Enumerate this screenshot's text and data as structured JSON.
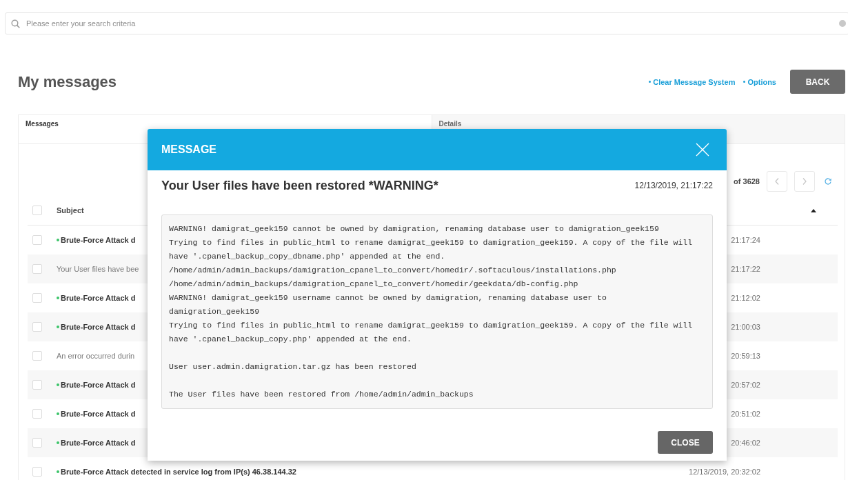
{
  "search": {
    "placeholder": "Please enter your search criteria"
  },
  "page": {
    "title": "My messages",
    "links": [
      "Clear Message System",
      "Options"
    ],
    "back_button": "BACK"
  },
  "panel": {
    "tabs": [
      {
        "label": "Messages",
        "selected": true
      },
      {
        "label": "Details",
        "selected": false
      }
    ],
    "pagination": {
      "summary": "of 3628"
    },
    "table": {
      "select_all": {
        "checked": false
      },
      "columns": [
        "Subject"
      ],
      "rows": [
        {
          "subject": "Brute-Force Attack d",
          "date": "21:17:24",
          "unread": true,
          "checked": false
        },
        {
          "subject": "Your User files have bee",
          "date": "21:17:22",
          "unread": false,
          "checked": false
        },
        {
          "subject": "Brute-Force Attack d",
          "date": "21:12:02",
          "unread": true,
          "checked": false
        },
        {
          "subject": "Brute-Force Attack d",
          "date": "21:00:03",
          "unread": true,
          "checked": false
        },
        {
          "subject": "An error occurred durin",
          "date": "20:59:13",
          "unread": false,
          "checked": false
        },
        {
          "subject": "Brute-Force Attack d",
          "date": "20:57:02",
          "unread": true,
          "checked": false
        },
        {
          "subject": "Brute-Force Attack d",
          "date": "20:51:02",
          "unread": true,
          "checked": false
        },
        {
          "subject": "Brute-Force Attack d",
          "date": "20:46:02",
          "unread": true,
          "checked": false
        },
        {
          "subject": "Brute-Force Attack detected in service log from IP(s) 46.38.144.32",
          "date": "12/13/2019, 20:32:02",
          "unread": true,
          "checked": false
        }
      ]
    }
  },
  "dialog": {
    "title": "MESSAGE",
    "subject": "Your User files have been restored *WARNING*",
    "date": "12/13/2019, 21:17:22",
    "body": [
      [
        "WARNING! damigrat_geek159 cannot be owned by damigration, renaming database user to damigration_geek159",
        "Trying to find files in public_html to rename damigrat_geek159 to damigration_geek159. A copy of the file will",
        "have '.cpanel_backup_copy_dbname.php' appended at the end.",
        "/home/admin/admin_backups/damigration_cpanel_to_convert/homedir/.softaculous/installations.php",
        "/home/admin/admin_backups/damigration_cpanel_to_convert/homedir/geekdata/db-config.php",
        "WARNING! damigrat_geek159 username cannot be owned by damigration, renaming database user to",
        "damigration_geek159",
        "Trying to find files in public_html to rename damigrat_geek159 to damigration_geek159. A copy of the file will",
        "have '.cpanel_backup_copy.php' appended at the end."
      ],
      [
        "User user.admin.damigration.tar.gz has been restored"
      ],
      [
        "The User files have been restored from /home/admin/admin_backups"
      ]
    ],
    "buttons": [
      "CLOSE"
    ]
  }
}
